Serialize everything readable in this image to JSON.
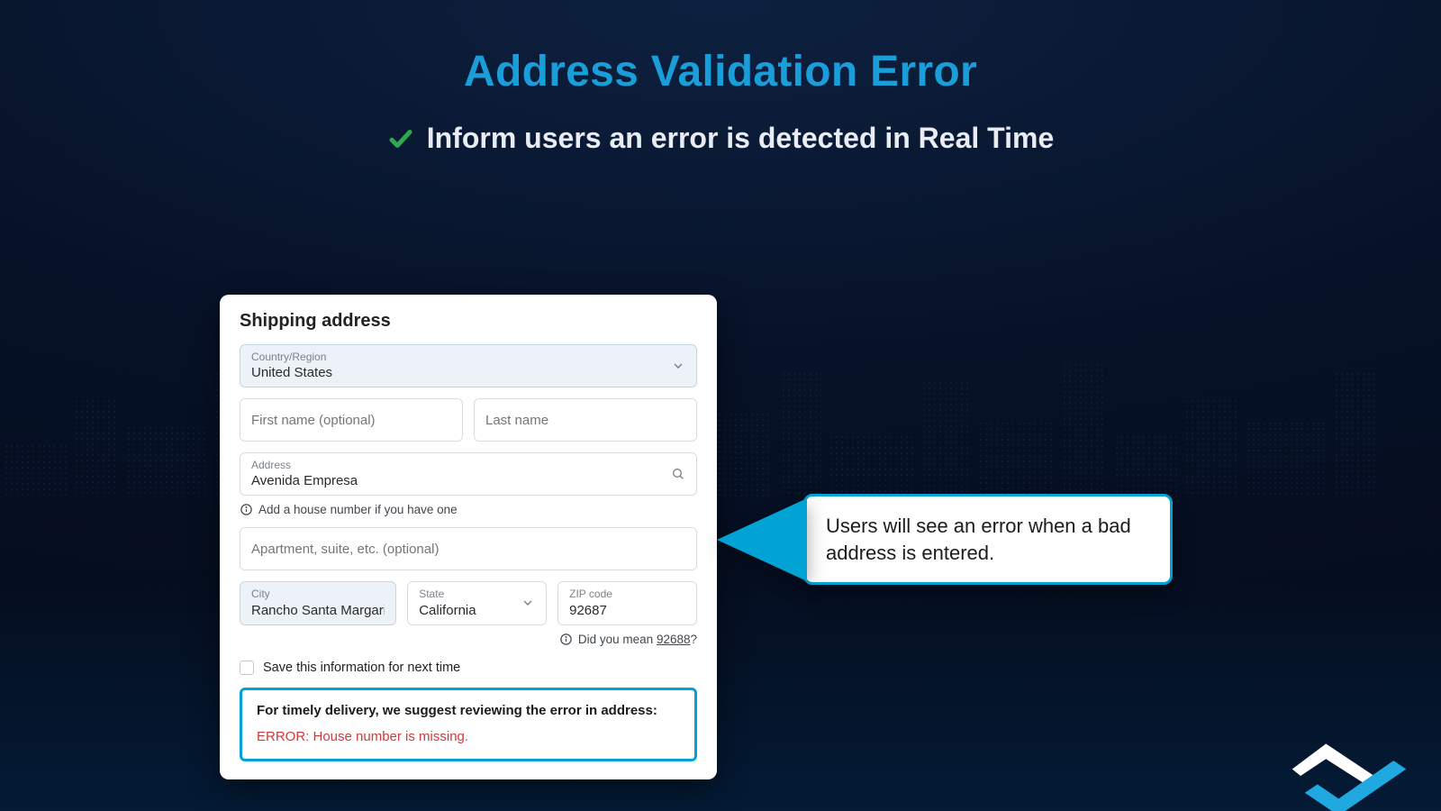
{
  "header": {
    "title": "Address Validation Error",
    "subtitle": "Inform users an error is detected in Real Time"
  },
  "form": {
    "heading": "Shipping address",
    "country": {
      "label": "Country/Region",
      "value": "United States"
    },
    "first_name": {
      "placeholder": "First name (optional)",
      "value": ""
    },
    "last_name": {
      "placeholder": "Last name",
      "value": ""
    },
    "address": {
      "label": "Address",
      "value": "Avenida Empresa"
    },
    "address_hint": "Add a house number if you have one",
    "apt": {
      "placeholder": "Apartment, suite, etc. (optional)",
      "value": ""
    },
    "city": {
      "label": "City",
      "value": "Rancho Santa Margarita"
    },
    "state": {
      "label": "State",
      "value": "California"
    },
    "zip": {
      "label": "ZIP code",
      "value": "92687"
    },
    "zip_hint_prefix": "Did you mean ",
    "zip_hint_suggestion": "92688",
    "zip_hint_suffix": "?",
    "save_label": "Save this information for next time",
    "error_lead": "For timely delivery, we suggest reviewing the error in address:",
    "error_msg": "ERROR: House number is missing."
  },
  "callout": {
    "text": "Users will see an error when a bad address is entered."
  },
  "colors": {
    "accent": "#1a9ed9",
    "callout_border": "#00a3d4",
    "error": "#d13a3a",
    "check": "#2fa84f"
  }
}
